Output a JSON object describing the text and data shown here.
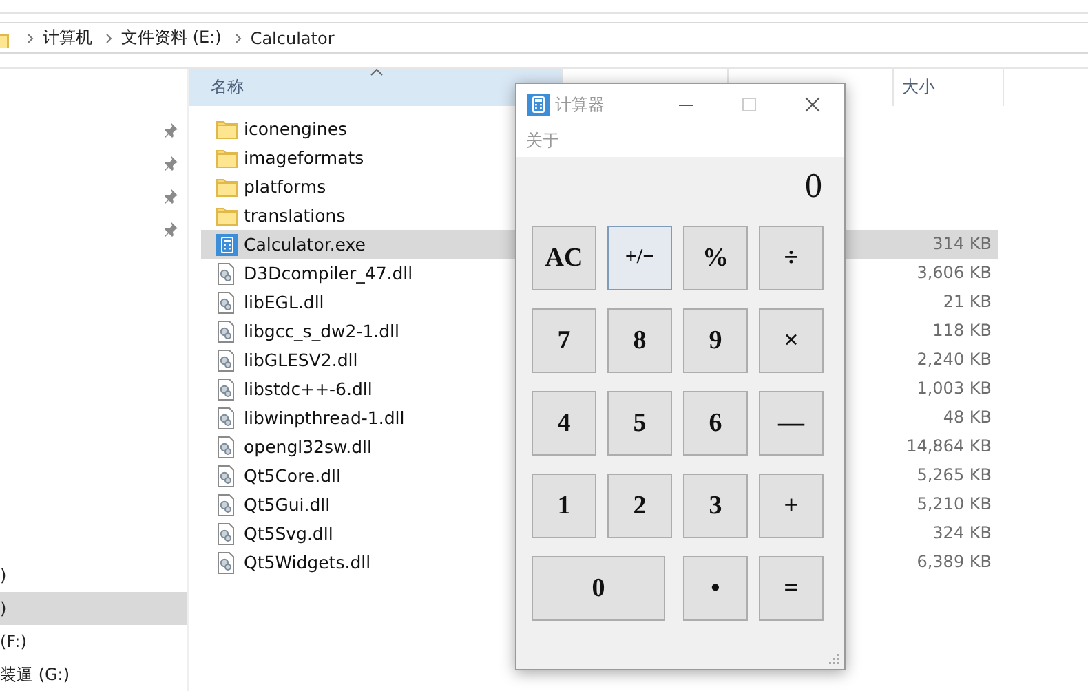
{
  "address_bar": {
    "crumbs": [
      "计算机",
      "文件资料 (E:)",
      "Calculator"
    ]
  },
  "nav_pane": {
    "drives": [
      {
        "label": ")",
        "selected": false
      },
      {
        "label": ")",
        "selected": true
      },
      {
        "label": "(F:)",
        "selected": false
      },
      {
        "label": "装逼 (G:)",
        "selected": false
      }
    ]
  },
  "columns": [
    {
      "label": "名称",
      "sorted": true
    },
    {
      "label": "大小",
      "sorted": false
    }
  ],
  "files": [
    {
      "name": "iconengines",
      "kind": "folder",
      "selected": false
    },
    {
      "name": "imageformats",
      "kind": "folder",
      "selected": false
    },
    {
      "name": "platforms",
      "kind": "folder",
      "selected": false
    },
    {
      "name": "translations",
      "kind": "folder",
      "selected": false
    },
    {
      "name": "Calculator.exe",
      "kind": "exe",
      "size": "314 KB",
      "selected": true
    },
    {
      "name": "D3Dcompiler_47.dll",
      "kind": "dll",
      "size": "3,606 KB",
      "selected": false
    },
    {
      "name": "libEGL.dll",
      "kind": "dll",
      "size": "21 KB",
      "selected": false
    },
    {
      "name": "libgcc_s_dw2-1.dll",
      "kind": "dll",
      "size": "118 KB",
      "selected": false
    },
    {
      "name": "libGLESV2.dll",
      "kind": "dll",
      "size": "2,240 KB",
      "selected": false
    },
    {
      "name": "libstdc++-6.dll",
      "kind": "dll",
      "size": "1,003 KB",
      "selected": false
    },
    {
      "name": "libwinpthread-1.dll",
      "kind": "dll",
      "size": "48 KB",
      "selected": false
    },
    {
      "name": "opengl32sw.dll",
      "kind": "dll",
      "size": "14,864 KB",
      "selected": false
    },
    {
      "name": "Qt5Core.dll",
      "kind": "dll",
      "size": "5,265 KB",
      "selected": false
    },
    {
      "name": "Qt5Gui.dll",
      "kind": "dll",
      "size": "5,210 KB",
      "selected": false
    },
    {
      "name": "Qt5Svg.dll",
      "kind": "dll",
      "size": "324 KB",
      "selected": false
    },
    {
      "name": "Qt5Widgets.dll",
      "kind": "dll",
      "size": "6,389 KB",
      "selected": false
    }
  ],
  "calculator": {
    "title": "计算器",
    "menu": [
      "关于"
    ],
    "display": "0",
    "keys": [
      {
        "label": "AC",
        "focused": false,
        "wide": false
      },
      {
        "label": "+/−",
        "focused": true,
        "wide": false
      },
      {
        "label": "%",
        "focused": false,
        "wide": false
      },
      {
        "label": "÷",
        "focused": false,
        "wide": false
      },
      {
        "label": "7",
        "focused": false,
        "wide": false
      },
      {
        "label": "8",
        "focused": false,
        "wide": false
      },
      {
        "label": "9",
        "focused": false,
        "wide": false
      },
      {
        "label": "×",
        "focused": false,
        "wide": false
      },
      {
        "label": "4",
        "focused": false,
        "wide": false
      },
      {
        "label": "5",
        "focused": false,
        "wide": false
      },
      {
        "label": "6",
        "focused": false,
        "wide": false
      },
      {
        "label": "—",
        "focused": false,
        "wide": false
      },
      {
        "label": "1",
        "focused": false,
        "wide": false
      },
      {
        "label": "2",
        "focused": false,
        "wide": false
      },
      {
        "label": "3",
        "focused": false,
        "wide": false
      },
      {
        "label": "+",
        "focused": false,
        "wide": false
      },
      {
        "label": "0",
        "focused": false,
        "wide": true
      },
      {
        "label": "•",
        "focused": false,
        "wide": false
      },
      {
        "label": "=",
        "focused": false,
        "wide": false
      }
    ]
  }
}
